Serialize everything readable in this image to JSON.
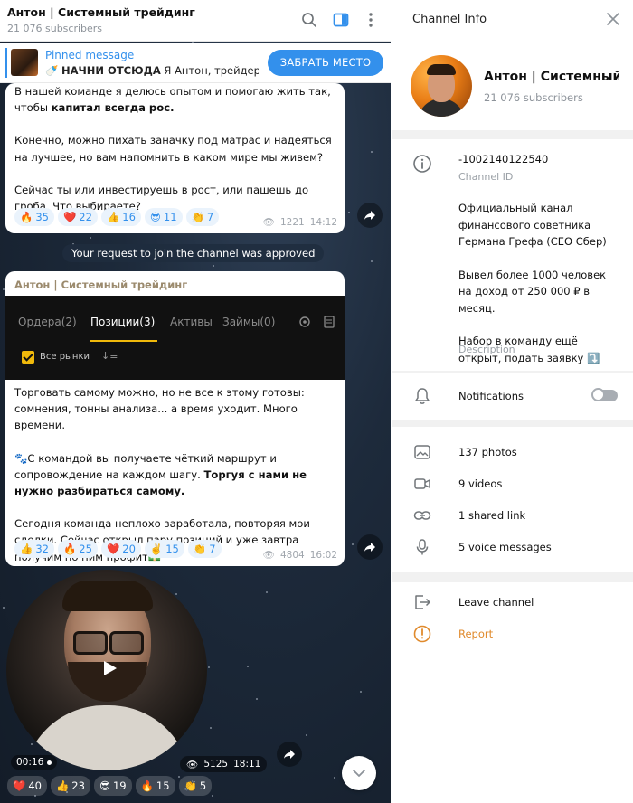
{
  "chat": {
    "title": "Антон | Системный трейдинг",
    "subscribers": "21 076 subscribers",
    "pinned": {
      "label": "Pinned message",
      "emoji": "🍼",
      "bold": "НАЧНИ ОТСЮДА",
      "text": " Я Антон, трейдер...",
      "button": "ЗАБРАТЬ МЕСТО"
    },
    "message1": {
      "paragraphs": [
        {
          "before": "В нашей команде я делюсь опытом и помогаю жить так, чтобы ",
          "bold": "капитал всегда рос."
        },
        {
          "before": "Конечно, можно пихать заначку под матрас и надеяться на лучшее, но вам напомнить в каком мире мы живем?",
          "bold": ""
        },
        {
          "before": "Сейчас ты или инвестируешь в рост, или пашешь до гроба. Что выбираете?",
          "bold": ""
        }
      ],
      "reactions": [
        {
          "emoji": "🔥",
          "count": "35"
        },
        {
          "emoji": "❤️",
          "count": "22"
        },
        {
          "emoji": "👍",
          "count": "16"
        },
        {
          "emoji": "😎",
          "count": "11"
        },
        {
          "emoji": "👏",
          "count": "7"
        }
      ],
      "views": "1221",
      "time": "14:12"
    },
    "service_message": "Your request to join the channel was approved",
    "message2": {
      "author": "Антон | Системный трейдинг",
      "screenshot": {
        "tabs": [
          {
            "label": "Ордера(2)",
            "active": false
          },
          {
            "label": "Позиции(3)",
            "active": true
          },
          {
            "label": "Активы",
            "active": false
          },
          {
            "label": "Займы(0)",
            "active": false
          }
        ],
        "filter": "Все рынки",
        "sort": "↓≡"
      },
      "paragraphs": [
        {
          "before": "Торговать самому можно, но не все к этому готовы: сомнения, тонны анализа... а время уходит. Много времени.",
          "bold": ""
        },
        {
          "before": "🐾С командой вы получаете чёткий маршрут и сопровождение на каждом шагу. ",
          "bold": "Торгуя с нами не нужно разбираться самому."
        },
        {
          "before": "Сегодня команда неплохо заработала, повторяя мои сделки. Сейчас открыл пару позиций и уже завтра получим по ним профит💵",
          "bold": ""
        }
      ],
      "reactions": [
        {
          "emoji": "👍",
          "count": "32"
        },
        {
          "emoji": "🔥",
          "count": "25"
        },
        {
          "emoji": "❤️",
          "count": "20"
        },
        {
          "emoji": "✌️",
          "count": "15"
        },
        {
          "emoji": "👏",
          "count": "7"
        }
      ],
      "views": "4804",
      "time": "16:02"
    },
    "video_message": {
      "duration": "00:16",
      "views": "5125",
      "time": "18:11",
      "reactions": [
        {
          "emoji": "❤️",
          "count": "40"
        },
        {
          "emoji": "👍",
          "count": "23"
        },
        {
          "emoji": "😎",
          "count": "19"
        },
        {
          "emoji": "🔥",
          "count": "15"
        },
        {
          "emoji": "👏",
          "count": "5"
        }
      ]
    }
  },
  "info": {
    "title": "Channel Info",
    "name": "Антон | Системный трейдинг",
    "subscribers": "21 076 subscribers",
    "channel_id": "-1002140122540",
    "channel_id_label": "Channel ID",
    "description": [
      "Официальный канал финансового советника Германа Грефа (CEO Сбер)",
      "Вывел более 1000 человек на доход от 250 000 ₽ в месяц.",
      "Набор в команду ещё открыт, подать заявку ⤵️"
    ],
    "description_label": "Description",
    "notifications_label": "Notifications",
    "notifications_on": false,
    "media": {
      "photos": "137 photos",
      "videos": "9 videos",
      "links": "1 shared link",
      "voice": "5 voice messages"
    },
    "leave": "Leave channel",
    "report": "Report"
  },
  "colors": {
    "accent": "#3390ec",
    "report": "#e08a2c",
    "chat_bg": "#1d2a3b"
  }
}
